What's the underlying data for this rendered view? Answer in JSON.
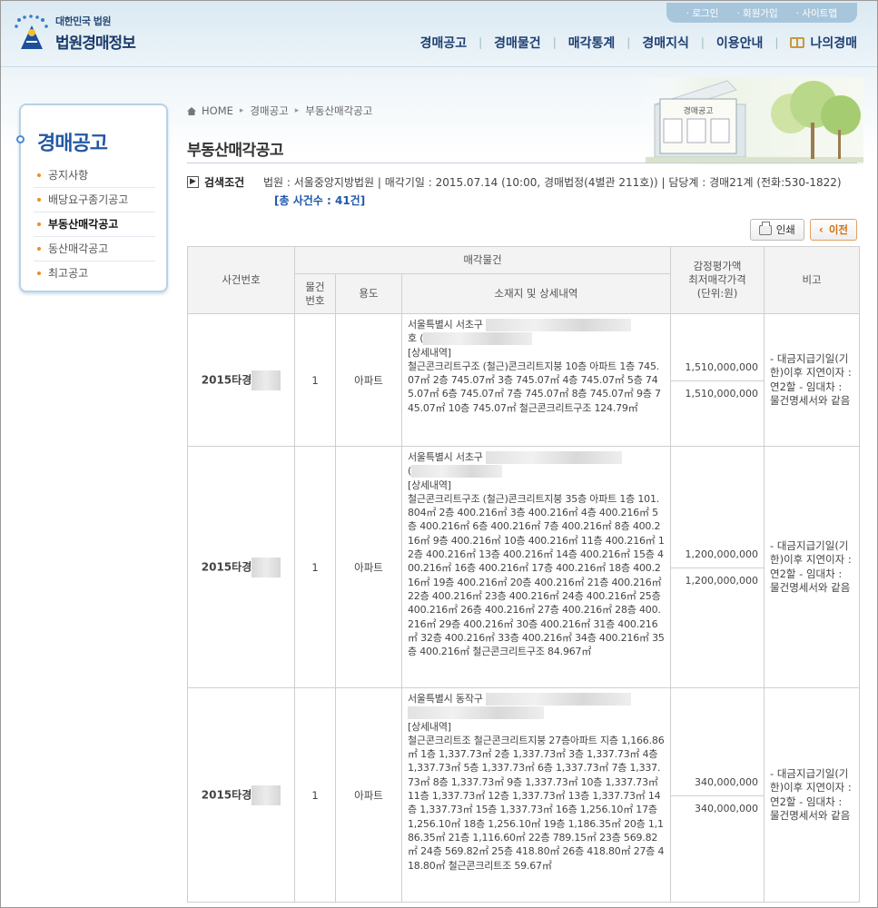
{
  "header": {
    "logo_sub": "대한민국 법원",
    "logo_main": "법원경매정보",
    "top_links": [
      "로그인",
      "회원가입",
      "사이트맵"
    ],
    "nav": [
      "경매공고",
      "경매물건",
      "매각통계",
      "경매지식",
      "이용안내",
      "나의경매"
    ]
  },
  "sidebar": {
    "title": "경매공고",
    "items": [
      "공지사항",
      "배당요구종기공고",
      "부동산매각공고",
      "동산매각공고",
      "최고공고"
    ],
    "active_index": 2
  },
  "illustration": {
    "board_title": "경매공고"
  },
  "breadcrumb": [
    "HOME",
    "경매공고",
    "부동산매각공고"
  ],
  "page_title": "부동산매각공고",
  "search": {
    "label": "검색조건",
    "text": "법원 : 서울중앙지방법원 | 매각기일 : 2015.07.14 (10:00, 경매법정(4별관 211호)) | 담당계 : 경매21계 (전화:530-1822)",
    "count": "[총 사건수 : 41건]"
  },
  "buttons": {
    "print": "인쇄",
    "prev": "이전"
  },
  "table": {
    "headers": {
      "case_no": "사건번호",
      "item_group": "매각물건",
      "item_no": "물건\n번호",
      "usage": "용도",
      "location": "소재지 및 상세내역",
      "price": "감정평가액\n최저매각가격\n(단위:원)",
      "note": "비고"
    },
    "rows": [
      {
        "case_no": "2015타경",
        "item_no": "1",
        "usage": "아파트",
        "addr_1": "서울특별시 서초구 ",
        "addr_2": "호 (",
        "detail_label": "[상세내역]",
        "detail": "철근콘크리트구조 (철근)콘크리트지붕 10층 아파트 1층 745.07㎡ 2층 745.07㎡ 3층 745.07㎡ 4층 745.07㎡ 5층 745.07㎡ 6층 745.07㎡ 7층 745.07㎡ 8층 745.07㎡ 9층 745.07㎡ 10층 745.07㎡ 철근콘크리트구조 124.79㎡",
        "appraisal": "1,510,000,000",
        "minimum": "1,510,000,000",
        "note": "- 대금지급기일(기한)이후 지연이자 : 연2할 - 임대차 : 물건명세서와 같음"
      },
      {
        "case_no": "2015타경",
        "item_no": "1",
        "usage": "아파트",
        "addr_1": "서울특별시 서초구 ",
        "addr_2": "(",
        "detail_label": "[상세내역]",
        "detail": "철근콘크리트구조 (철근)콘크리트지붕 35층 아파트 1층 101.804㎡ 2층 400.216㎡ 3층 400.216㎡ 4층 400.216㎡ 5층 400.216㎡ 6층 400.216㎡ 7층 400.216㎡ 8층 400.216㎡ 9층 400.216㎡ 10층 400.216㎡ 11층 400.216㎡ 12층 400.216㎡ 13층 400.216㎡ 14층 400.216㎡ 15층 400.216㎡ 16층 400.216㎡ 17층 400.216㎡ 18층 400.216㎡ 19층 400.216㎡ 20층 400.216㎡ 21층 400.216㎡ 22층 400.216㎡ 23층 400.216㎡ 24층 400.216㎡ 25층 400.216㎡ 26층 400.216㎡ 27층 400.216㎡ 28층 400.216㎡ 29층 400.216㎡ 30층 400.216㎡ 31층 400.216㎡ 32층 400.216㎡ 33층 400.216㎡ 34층 400.216㎡ 35층 400.216㎡ 철근콘크리트구조 84.967㎡",
        "appraisal": "1,200,000,000",
        "minimum": "1,200,000,000",
        "note": "- 대금지급기일(기한)이후 지연이자 : 연2할 - 임대차 : 물건명세서와 같음"
      },
      {
        "case_no": "2015타경",
        "item_no": "1",
        "usage": "아파트",
        "addr_1": "서울특별시 동작구 ",
        "addr_2": "",
        "detail_label": "[상세내역]",
        "detail": "철근콘크리트조 철근콘크리트지붕 27층아파트 지층 1,166.86㎡ 1층 1,337.73㎡ 2층 1,337.73㎡ 3층 1,337.73㎡ 4층 1,337.73㎡ 5층 1,337.73㎡ 6층 1,337.73㎡ 7층 1,337.73㎡ 8층 1,337.73㎡ 9층 1,337.73㎡ 10층 1,337.73㎡ 11층 1,337.73㎡ 12층 1,337.73㎡ 13층 1,337.73㎡ 14층 1,337.73㎡ 15층 1,337.73㎡ 16층 1,256.10㎡ 17층 1,256.10㎡ 18층 1,256.10㎡ 19층 1,186.35㎡ 20층 1,186.35㎡ 21층 1,116.60㎡ 22층 789.15㎡ 23층 569.82㎡ 24층 569.82㎡ 25층 418.80㎡ 26층 418.80㎡ 27층 418.80㎡ 철근콘크리트조 59.67㎡",
        "appraisal": "340,000,000",
        "minimum": "340,000,000",
        "note": "- 대금지급기일(기한)이후 지연이자 : 연2할 - 임대차 : 물건명세서와 같음"
      }
    ]
  }
}
